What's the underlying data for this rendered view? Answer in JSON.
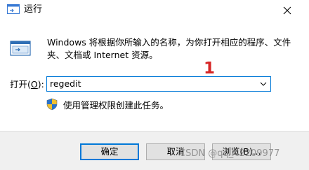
{
  "window": {
    "title": "运行",
    "app_icon": "run-app-icon",
    "close_icon": "close-icon"
  },
  "description": "Windows 将根据你所输入的名称，为你打开相应的程序、文件夹、文档或 Internet 资源。",
  "open_field": {
    "label_prefix": "打开(",
    "label_accel": "O",
    "label_suffix": "):",
    "value": "regedit",
    "dropdown_icon": "chevron-down-icon"
  },
  "annotation": "1",
  "admin_notice": {
    "icon": "shield-icon",
    "text": "使用管理权限创建此任务。"
  },
  "buttons": {
    "ok_label": "确定",
    "cancel_label": "取消",
    "browse_label": "浏览(B)..."
  },
  "watermark": "CSDN @qq_42209977",
  "colors": {
    "accent": "#0078d7",
    "annotation": "#d62525",
    "footer_bg": "#f0f0f0"
  }
}
